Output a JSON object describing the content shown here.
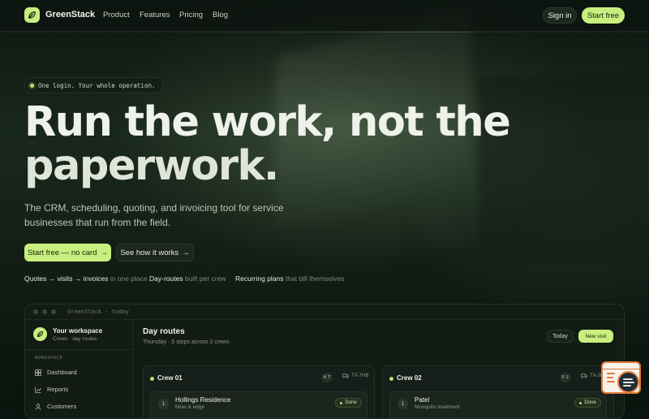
{
  "nav": {
    "brand": "GreenStack",
    "links": [
      "Product",
      "Features",
      "Pricing",
      "Blog"
    ],
    "signin": "Sign in",
    "start": "Start free"
  },
  "hero": {
    "pill": "One login. Your whole operation.",
    "headline_line1": "Run the work, not the",
    "headline_line2": "paperwork.",
    "subtitle": "The CRM, scheduling, quoting, and invoicing tool for service businesses that run from the field.",
    "cta_primary": "Start free — no card",
    "cta_secondary": "See how it works",
    "features": [
      {
        "strong": "Quotes → visits → invoices",
        "dim": "in one place"
      },
      {
        "strong": "Day-routes",
        "dim": "built per crew"
      },
      {
        "strong": "Recurring plans",
        "dim": "that bill themselves"
      }
    ]
  },
  "app": {
    "window_title": "GreenStack · today",
    "workspace_name": "Your workspace",
    "workspace_sub": "Crews · day routes",
    "section_head": "WORKSPACE",
    "sidebar_items": [
      "Dashboard",
      "Reports",
      "Customers"
    ],
    "main_title": "Day routes",
    "main_sub": "Thursday · 5 stops across 2 crews",
    "today_btn": "Today",
    "new_visit_btn": "New visit",
    "crews": [
      {
        "name": "Crew 01",
        "initials": "K T",
        "truck": "TX-7HB",
        "visit": {
          "num": "1",
          "title": "Hollings Residence",
          "sub": "Mow & edge",
          "status": "Done"
        }
      },
      {
        "name": "Crew 02",
        "initials": "F J",
        "truck": "TX-3K",
        "visit": {
          "num": "1",
          "title": "Patel",
          "sub": "Mosquito treatment",
          "status": "Done"
        }
      }
    ]
  },
  "colors": {
    "accent": "#c8ef7d",
    "background": "#0c140f",
    "widget_border": "#e07a3a"
  }
}
